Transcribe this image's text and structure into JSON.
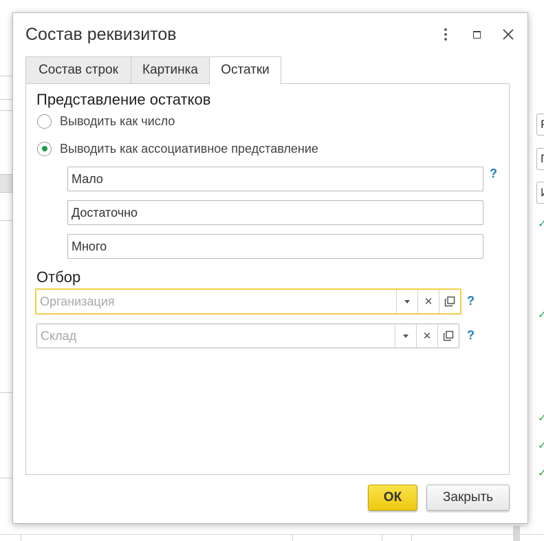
{
  "dialog": {
    "title": "Состав реквизитов",
    "window_controls": {
      "menu_icon": "kebab-vertical-icon",
      "maximize_icon": "maximize-icon",
      "close_icon": "close-icon"
    }
  },
  "tabs": [
    {
      "label": "Состав строк",
      "active": false
    },
    {
      "label": "Картинка",
      "active": false
    },
    {
      "label": "Остатки",
      "active": true
    }
  ],
  "balance_view": {
    "section_title": "Представление остатков",
    "options": [
      {
        "label": "Выводить как число",
        "selected": false
      },
      {
        "label": "Выводить как ассоциативное представление",
        "selected": true
      }
    ],
    "fields": [
      {
        "value": "Мало"
      },
      {
        "value": "Достаточно"
      },
      {
        "value": "Много"
      }
    ],
    "help": "?"
  },
  "filter": {
    "section_title": "Отбор",
    "organization": {
      "value": "",
      "placeholder": "Организация",
      "help": "?"
    },
    "warehouse": {
      "value": "",
      "placeholder": "Склад",
      "help": "?"
    }
  },
  "buttons": {
    "ok_label": "ОК",
    "close_label": "Закрыть"
  },
  "background": {
    "right_field_letters": [
      "Р",
      "П",
      "И"
    ]
  },
  "colors": {
    "ok_button": "#f5d62a",
    "focus_border": "#f2cf4a",
    "radio_selected": "#1e9a4a",
    "help_link": "#1f7fbf",
    "bg_check": "#2ca34a"
  }
}
